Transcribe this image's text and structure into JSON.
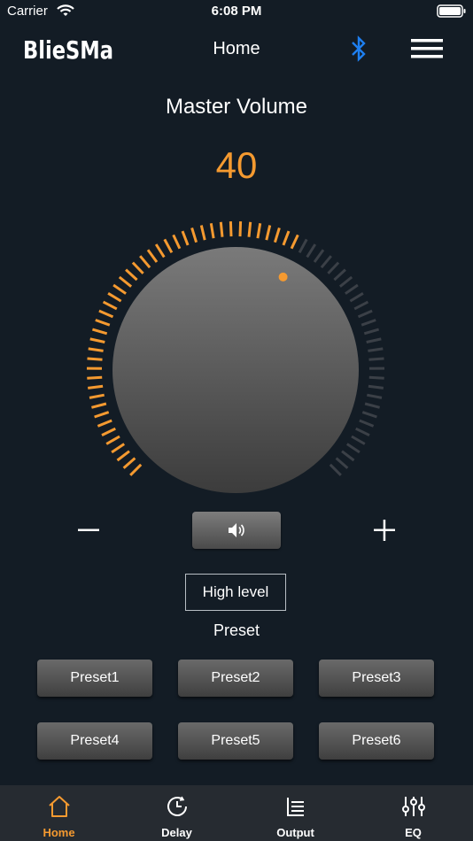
{
  "status_bar": {
    "carrier": "Carrier",
    "time": "6:08 PM"
  },
  "nav": {
    "logo": "Bliesma",
    "title": "Home"
  },
  "volume": {
    "title": "Master Volume",
    "value": "40",
    "level": 0.6
  },
  "controls": {
    "level_mode": "High level"
  },
  "presets": {
    "title": "Preset",
    "items": [
      "Preset1",
      "Preset2",
      "Preset3",
      "Preset4",
      "Preset5",
      "Preset6"
    ]
  },
  "tabs": [
    {
      "label": "Home",
      "icon": "home-icon",
      "active": true
    },
    {
      "label": "Delay",
      "icon": "delay-clock-icon",
      "active": false
    },
    {
      "label": "Output",
      "icon": "output-list-icon",
      "active": false
    },
    {
      "label": "EQ",
      "icon": "eq-sliders-icon",
      "active": false
    }
  ],
  "colors": {
    "background": "#131c25",
    "accent": "#f59a30",
    "bluetooth": "#1e7ff0",
    "tabbar": "#262b31"
  }
}
